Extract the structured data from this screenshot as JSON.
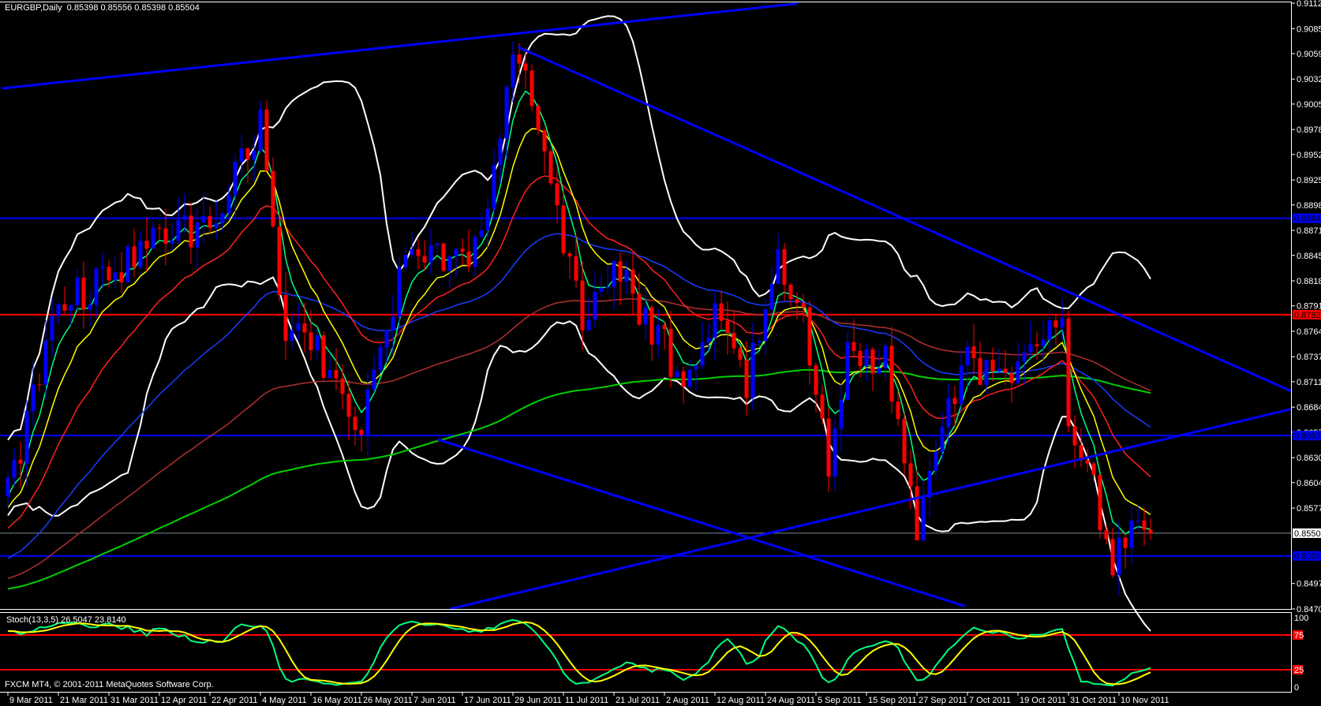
{
  "header": {
    "symbol_timeframe": "EURGBP,Daily",
    "ohlc": "0.85398 0.85556 0.85398 0.85504"
  },
  "footer": {
    "copyright": "FXCM MT4, © 2001-2011 MetaQuotes Software Corp."
  },
  "colors": {
    "background": "#000000",
    "bull_candle": "#0000ff",
    "bear_candle": "#ff0000",
    "ma5": "#00ff80",
    "ma10": "#ffff00",
    "ma21": "#ff2020",
    "ma50": "#1a3cff",
    "ma100": "#b03030",
    "ma200": "#00d000",
    "bollinger": "#ffffff",
    "trendline": "#0000ff",
    "stoch_main": "#00ff80",
    "stoch_signal": "#ffff00",
    "stoch_levels": "#ff0000"
  },
  "chart_data": [
    {
      "type": "candlestick",
      "title": "EURGBP,Daily",
      "ylim": [
        0.847,
        0.91125
      ],
      "bars": 182,
      "price_ticks": [
        "0.91125",
        "0.90855",
        "0.90590",
        "0.90320",
        "0.90055",
        "0.89785",
        "0.89520",
        "0.89250",
        "0.88985",
        "0.88715",
        "0.88450",
        "0.88180",
        "0.87915",
        "0.87645",
        "0.87375",
        "0.87110",
        "0.86840",
        "0.86575",
        "0.86305",
        "0.86040",
        "0.85770",
        "0.84970",
        "0.84700"
      ],
      "date_ticks": [
        {
          "bar": 0,
          "label": "9 Mar 2011"
        },
        {
          "bar": 8,
          "label": "21 Mar 2011"
        },
        {
          "bar": 16,
          "label": "31 Mar 2011"
        },
        {
          "bar": 24,
          "label": "12 Apr 2011"
        },
        {
          "bar": 32,
          "label": "22 Apr 2011"
        },
        {
          "bar": 40,
          "label": "4 May 2011"
        },
        {
          "bar": 48,
          "label": "16 May 2011"
        },
        {
          "bar": 56,
          "label": "26 May 2011"
        },
        {
          "bar": 64,
          "label": "7 Jun 2011"
        },
        {
          "bar": 72,
          "label": "17 Jun 2011"
        },
        {
          "bar": 80,
          "label": "29 Jun 2011"
        },
        {
          "bar": 88,
          "label": "11 Jul 2011"
        },
        {
          "bar": 96,
          "label": "21 Jul 2011"
        },
        {
          "bar": 104,
          "label": "2 Aug 2011"
        },
        {
          "bar": 112,
          "label": "12 Aug 2011"
        },
        {
          "bar": 120,
          "label": "24 Aug 2011"
        },
        {
          "bar": 128,
          "label": "5 Sep 2011"
        },
        {
          "bar": 136,
          "label": "15 Sep 2011"
        },
        {
          "bar": 144,
          "label": "27 Sep 2011"
        },
        {
          "bar": 152,
          "label": "7 Oct 2011"
        },
        {
          "bar": 160,
          "label": "19 Oct 2011"
        },
        {
          "bar": 168,
          "label": "31 Oct 2011"
        },
        {
          "bar": 176,
          "label": "10 Nov 2011"
        }
      ],
      "close_path": [
        [
          0,
          0.859
        ],
        [
          8,
          0.8795
        ],
        [
          16,
          0.882
        ],
        [
          24,
          0.887
        ],
        [
          32,
          0.8875
        ],
        [
          38,
          0.896
        ],
        [
          40,
          0.899
        ],
        [
          44,
          0.875
        ],
        [
          48,
          0.876
        ],
        [
          56,
          0.866
        ],
        [
          64,
          0.8866
        ],
        [
          72,
          0.883
        ],
        [
          77,
          0.893
        ],
        [
          80,
          0.906
        ],
        [
          83,
          0.901
        ],
        [
          88,
          0.8848
        ],
        [
          91,
          0.878
        ],
        [
          96,
          0.883
        ],
        [
          104,
          0.875
        ],
        [
          107,
          0.8707
        ],
        [
          112,
          0.878
        ],
        [
          117,
          0.871
        ],
        [
          122,
          0.8848
        ],
        [
          126,
          0.877
        ],
        [
          130,
          0.8626
        ],
        [
          133,
          0.874
        ],
        [
          139,
          0.873
        ],
        [
          144,
          0.8553
        ],
        [
          148,
          0.866
        ],
        [
          152,
          0.873
        ],
        [
          160,
          0.872
        ],
        [
          165,
          0.876
        ],
        [
          167,
          0.879
        ],
        [
          168,
          0.865
        ],
        [
          172,
          0.8595
        ],
        [
          175,
          0.852
        ],
        [
          177,
          0.854
        ],
        [
          179,
          0.8555
        ],
        [
          181,
          0.85504
        ]
      ],
      "horizontal_levels": [
        {
          "price": 0.88844,
          "label": "0.88844",
          "color": "#0000ff"
        },
        {
          "price": 0.87821,
          "label": "0.87821",
          "color": "#ff0000"
        },
        {
          "price": 0.86539,
          "label": "0.86539",
          "color": "#0000ff"
        },
        {
          "price": 0.85263,
          "label": "0.85263",
          "color": "#0000ff"
        }
      ],
      "current_price": {
        "price": 0.85504,
        "label": "0.85504"
      },
      "trendlines": [
        {
          "from": [
            -1,
            0.9022
          ],
          "to": [
            125,
            0.9112
          ]
        },
        {
          "from": [
            80.8,
            0.9066
          ],
          "to": [
            203.3,
            0.8701
          ]
        },
        {
          "from": [
            68,
            0.865
          ],
          "to": [
            151.6,
            0.8473
          ]
        },
        {
          "from": [
            70,
            0.847
          ],
          "to": [
            203.3,
            0.8682
          ]
        }
      ]
    },
    {
      "type": "line",
      "title": "Stoch(13,3,5) 26.5047 23.8140",
      "label": "Stoch(13,3,5)",
      "values_shown": "26.5047 23.8140",
      "ylim": [
        0,
        100
      ],
      "levels": [
        75,
        25
      ],
      "tick_labels": [
        "100",
        "75",
        "25",
        "0"
      ]
    }
  ]
}
